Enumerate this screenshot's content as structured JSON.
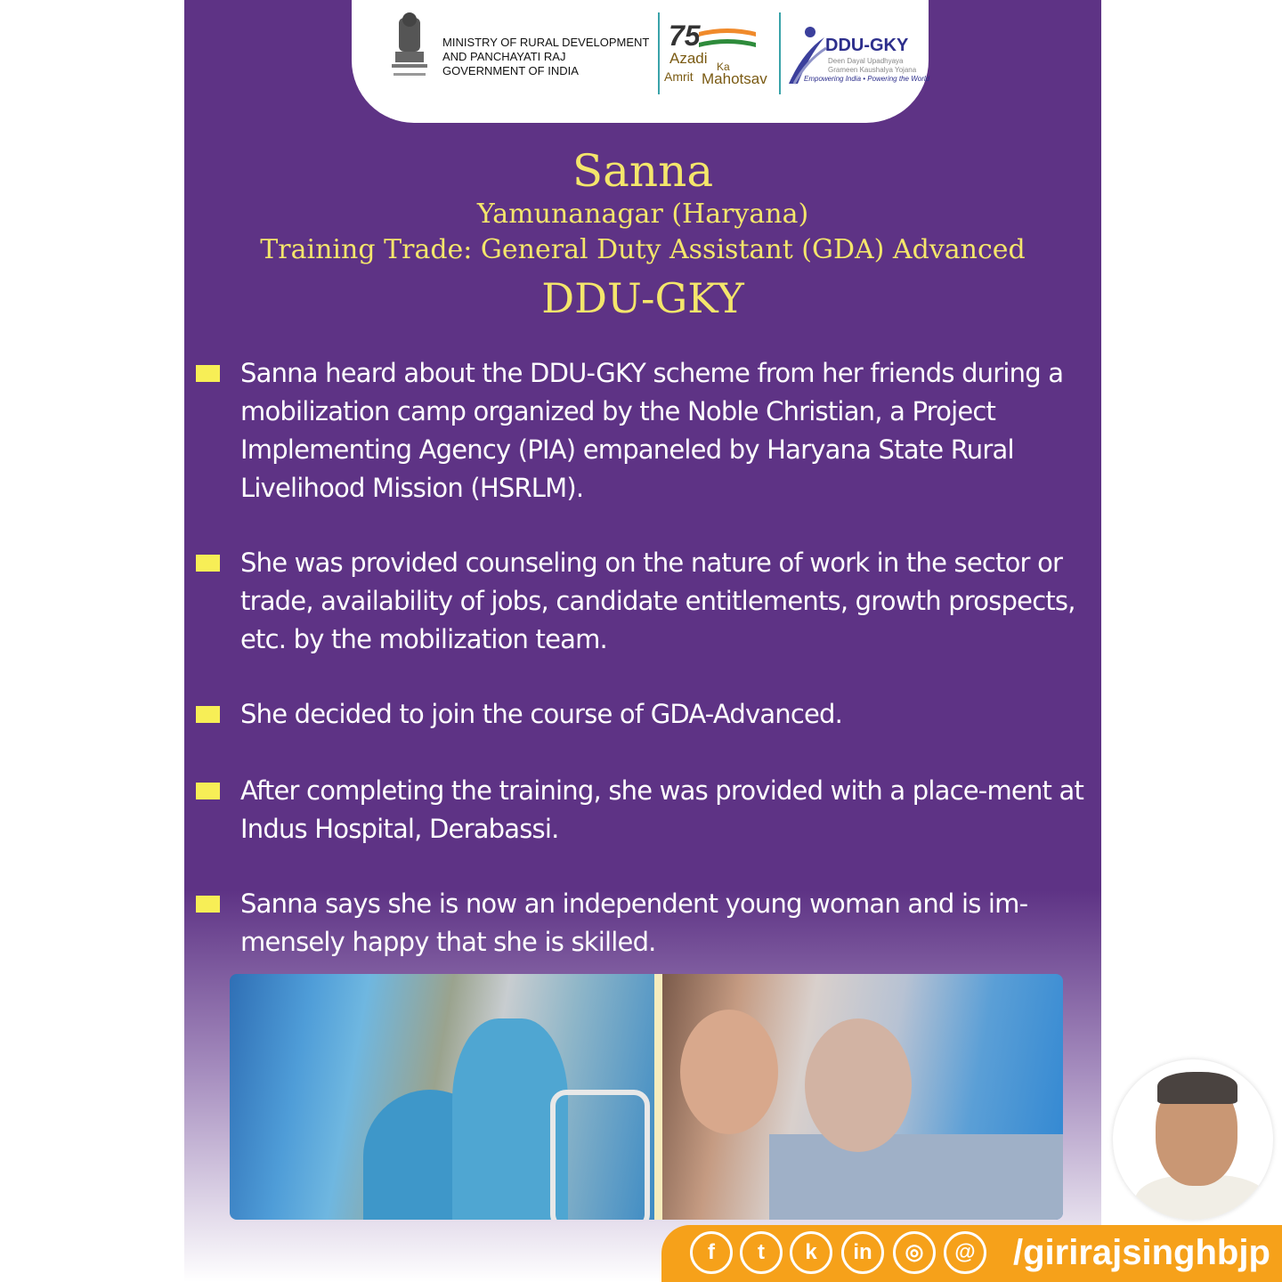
{
  "header": {
    "ministry_line1": "MINISTRY OF RURAL DEVELOPMENT",
    "ministry_line2": "AND PANCHAYATI RAJ",
    "ministry_line3": "GOVERNMENT OF INDIA",
    "azadi_number": "75",
    "azadi_word": "Azadi",
    "azadi_ka": "Ka",
    "azadi_amrit": "Amrit",
    "azadi_mahotsav": "Mahotsav",
    "ddu_logo_title": "DDU-GKY",
    "ddu_logo_sub1": "Deen Dayal Upadhyaya",
    "ddu_logo_sub2": "Grameen Kaushalya Yojana",
    "ddu_logo_tagline": "Empowering India • Powering the World"
  },
  "profile": {
    "name": "Sanna",
    "location": "Yamunanagar (Haryana)",
    "trade": "Training Trade: General Duty Assistant (GDA) Advanced",
    "scheme": "DDU-GKY"
  },
  "bullets": [
    "Sanna heard about the DDU-GKY scheme from her friends during a mobilization camp organized by the Noble Christian, a Project Implementing Agency (PIA) empaneled by Haryana State Rural Livelihood Mission (HSRLM).",
    "She was provided counseling on the nature of work in the sector or trade, availability of jobs, candidate entitlements, growth prospects, etc. by the mobilization team.",
    "She decided to join the course of GDA-Advanced.",
    "After completing the training, she was provided with a place-ment at Indus Hospital, Derabassi.",
    "Sanna says she is now an independent young woman and is im-mensely happy that she is skilled."
  ],
  "social": {
    "icons": [
      "facebook-icon",
      "twitter-icon",
      "koo-icon",
      "linkedin-icon",
      "instagram-icon",
      "threads-icon"
    ],
    "icon_glyphs": [
      "f",
      "t",
      "k",
      "in",
      "◎",
      "@"
    ],
    "handle": "/girirajsinghbjp"
  },
  "colors": {
    "panel": "#5e3385",
    "title_yellow": "#f4e66b",
    "bullet_square": "#f7ee56",
    "social_bar": "#f6a11a"
  }
}
